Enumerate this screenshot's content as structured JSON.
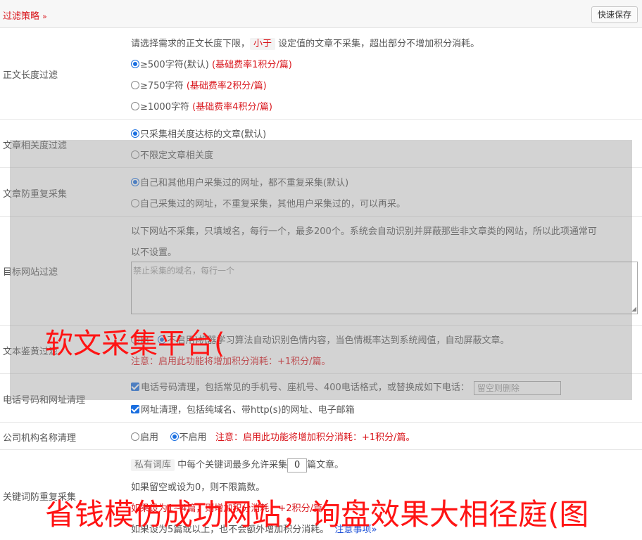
{
  "header": {
    "title": "过滤策略",
    "chevron": "»",
    "quick_save": "快速保存"
  },
  "length_filter": {
    "label": "正文长度过滤",
    "desc_before": "请选择需求的正文长度下限，",
    "desc_tag": "小于",
    "desc_after": "设定值的文章不采集，超出部分不增加积分消耗。",
    "options": [
      {
        "text": "≥500字符(默认)",
        "note": "(基础费率1积分/篇)",
        "selected": true
      },
      {
        "text": "≥750字符",
        "note": "(基础费率2积分/篇)",
        "selected": false
      },
      {
        "text": "≥1000字符",
        "note": "(基础费率4积分/篇)",
        "selected": false
      }
    ]
  },
  "relevance_filter": {
    "label": "文章相关度过滤",
    "options": [
      {
        "text": "只采集相关度达标的文章(默认)",
        "selected": true
      },
      {
        "text": "不限定文章相关度",
        "selected": false
      }
    ]
  },
  "dedupe": {
    "label": "文章防重复采集",
    "options": [
      {
        "text": "自己和其他用户采集过的网址，都不重复采集(默认)",
        "selected": true
      },
      {
        "text": "自己采集过的网址，不重复采集，其他用户采集过的，可以再采。",
        "selected": false
      }
    ]
  },
  "site_filter": {
    "label": "目标网站过滤",
    "desc_line1": "以下网站不采集，只填域名，每行一个，最多200个。系统会自动识别并屏蔽那些非文章类的网站，所以此项通常可",
    "desc_line2": "以不设置。",
    "placeholder": "禁止采集的域名，每行一个"
  },
  "porn_filter": {
    "label": "文本鉴黄过滤",
    "option_on_fragment": "启",
    "option_off_fragment": "不启",
    "desc_fragment": "用)机器学习算法自动识别色情内容，当色情概率达到系统阈值，自动屏蔽文章。",
    "note": "注意：启用此功能将增加积分消耗：+1积分/篇。"
  },
  "contact_clean": {
    "label": "电话号码和网址清理",
    "phone_text": "电话号码清理，包括常见的手机号、座机号、400电话格式，或替换成如下电话：",
    "phone_placeholder": "留空则删除",
    "url_text": "网址清理，包括纯域名、带http(s)的网址、电子邮箱"
  },
  "org_clean": {
    "label": "公司机构名称清理",
    "on": "启用",
    "off": "不启用",
    "note": "注意：启用此功能将增加积分消耗：+1积分/篇。"
  },
  "keyword_dedupe": {
    "label": "关键词防重复采集",
    "tag": "私有词库",
    "text_before": "中每个关键词最多允许采集",
    "value": "0",
    "text_after": "篇文章。",
    "line2": "如果留空或设为0，则不限篇数。",
    "line3_fragment": "如果设为1~4篇，则增加积分消耗：+2积分/篇",
    "line4": "如果设为5篇或以上，也不会额外增加积分消耗。",
    "notice_link": "注意事项",
    "notice_chevron": "»"
  },
  "watermarks": {
    "top": "软文采集平台(",
    "bottom": "省钱模仿成功网站，询盘效果大相径庭(图"
  }
}
